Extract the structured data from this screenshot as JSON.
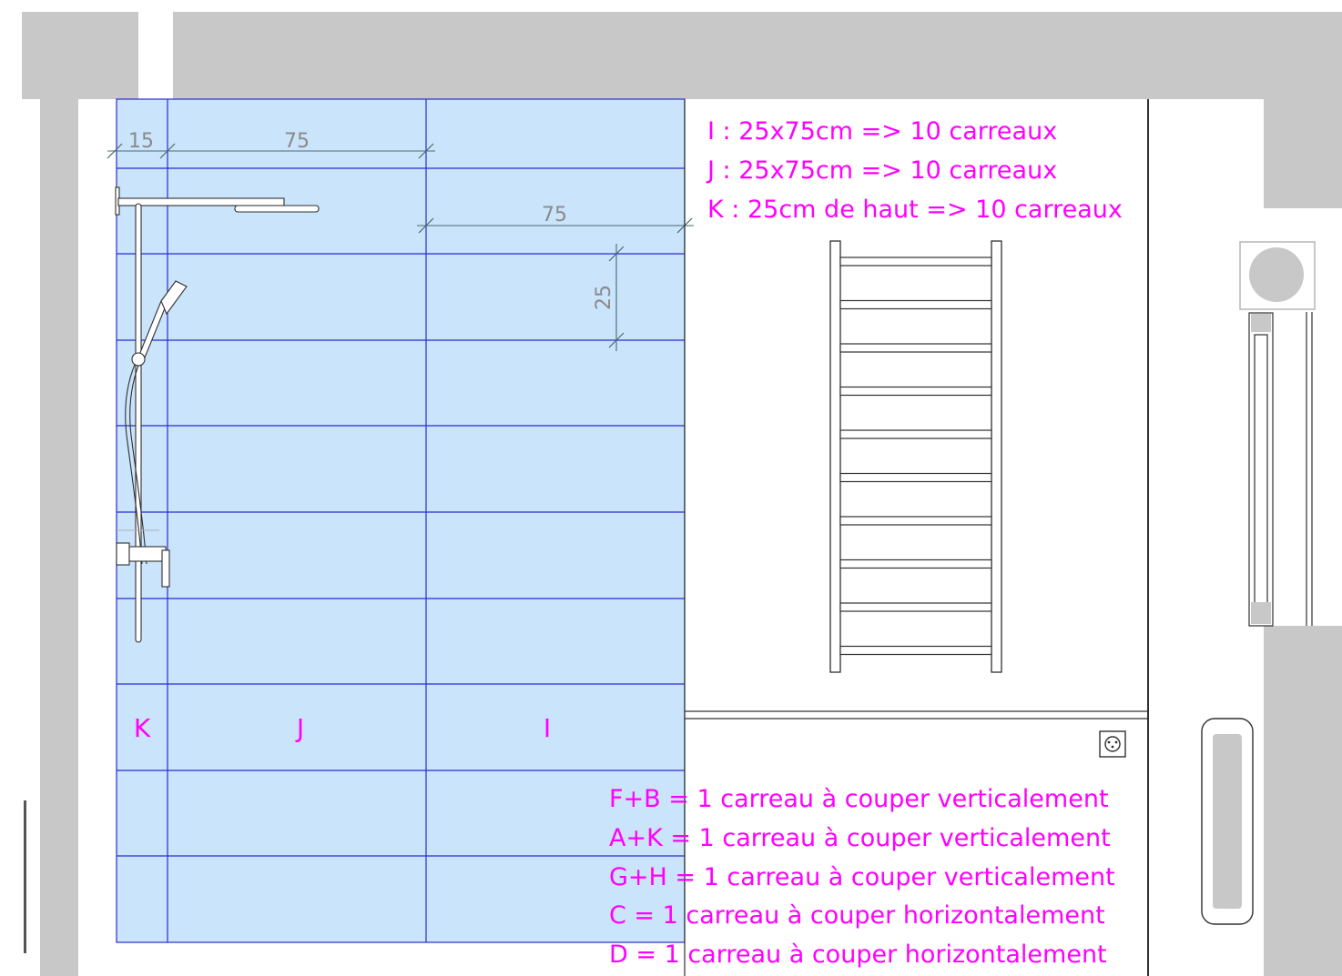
{
  "colors": {
    "background": "#ffffff",
    "wall": "#c8c8c8",
    "tile_fill": "#c9e4fb",
    "tile_grid": "#2b2bd1",
    "annotation": "#ff00ff",
    "dimension_line": "#4a6b6b",
    "dimension_text": "#8a8a8a",
    "fixture": "#303030"
  },
  "dimensions": {
    "k_width": "15",
    "j_width": "75",
    "i_width": "75",
    "tile_height": "25"
  },
  "zones": {
    "k": "K",
    "j": "J",
    "i": "I"
  },
  "notes_top": [
    "I : 25x75cm => 10 carreaux",
    "J : 25x75cm => 10 carreaux",
    "K : 25cm de haut => 10 carreaux"
  ],
  "notes_bottom": [
    "F+B = 1 carreau à couper verticalement",
    "A+K = 1 carreau à couper verticalement",
    "G+H = 1 carreau à couper verticalement",
    "C = 1 carreau à couper horizontalement",
    "D = 1 carreau à couper horizontalement"
  ],
  "icons": {
    "shower": "shower-column-icon",
    "towel_rail": "towel-radiator-icon",
    "outlet": "power-outlet-icon",
    "window": "window-icon"
  }
}
